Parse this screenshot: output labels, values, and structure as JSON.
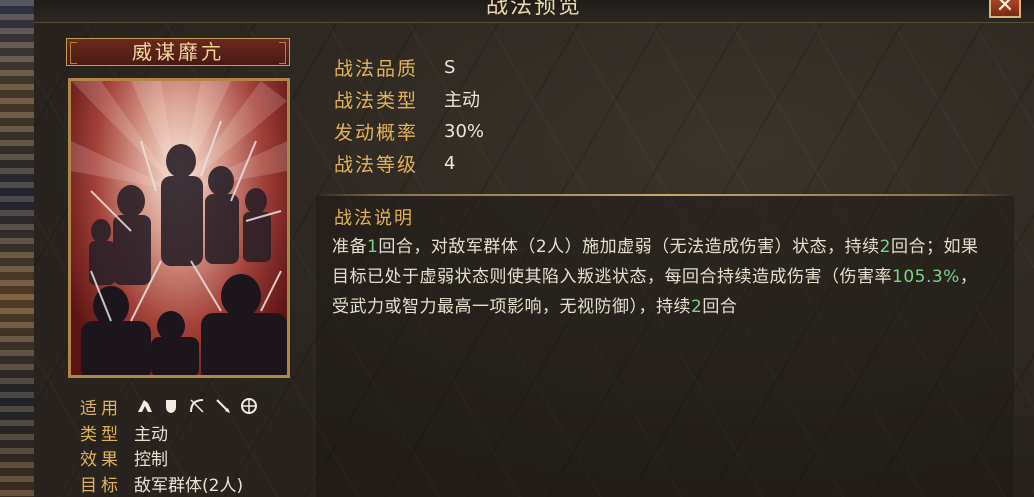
{
  "dialog": {
    "title": "战法预览",
    "close_icon": "close-x-icon"
  },
  "skill": {
    "name": "威谋靡亢",
    "attributes": [
      {
        "label": "战法品质",
        "value": "S"
      },
      {
        "label": "战法类型",
        "value": "主动"
      },
      {
        "label": "发动概率",
        "value": "30%"
      },
      {
        "label": "战法等级",
        "value": "4"
      }
    ],
    "description_heading": "战法说明",
    "description": {
      "p1": "准备",
      "n1": "1",
      "p2": "回合，对敌军群体（2人）施加虚弱（无法造成伤害）状态，持续",
      "n2": "2",
      "p3": "回合；如果目标已处于虚弱状态则使其陷入叛逃状态，每回合持续造成伤害（伤害率",
      "n3": "105.3%",
      "p4": "，受武力或智力最高一项影响，无视防御），持续",
      "n4": "2",
      "p5": "回合"
    }
  },
  "card_info": {
    "applicable_label": "适用",
    "applicable_icons": [
      "cavalry-icon",
      "shield-icon",
      "bow-icon",
      "spear-icon",
      "wheel-icon"
    ],
    "type_label": "类型",
    "type_value": "主动",
    "effect_label": "效果",
    "effect_value": "控制",
    "target_label": "目标",
    "target_value": "敌军群体(2人)"
  },
  "colors": {
    "gold_label": "#e0b35a",
    "highlight_green": "#7fd18a",
    "text": "#e6dfcf"
  }
}
